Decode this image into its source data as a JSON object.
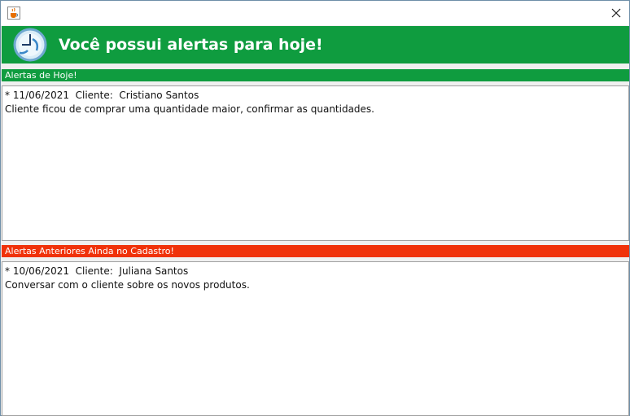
{
  "banner": {
    "title": "Você possui alertas para hoje!"
  },
  "today": {
    "header": "Alertas de Hoje!",
    "lines": [
      "* 11/06/2021  Cliente:  Cristiano Santos",
      "Cliente ficou de comprar uma quantidade maior, confirmar as quantidades."
    ]
  },
  "previous": {
    "header": "Alertas Anteriores Ainda no Cadastro!",
    "lines": [
      "* 10/06/2021  Cliente:  Juliana Santos",
      "Conversar com o cliente sobre os novos produtos."
    ]
  },
  "colors": {
    "banner_green": "#0f9c3f",
    "previous_red": "#f0320a"
  },
  "icons": {
    "app": "java-cup-icon",
    "close": "close-icon",
    "banner": "clock-icon"
  }
}
